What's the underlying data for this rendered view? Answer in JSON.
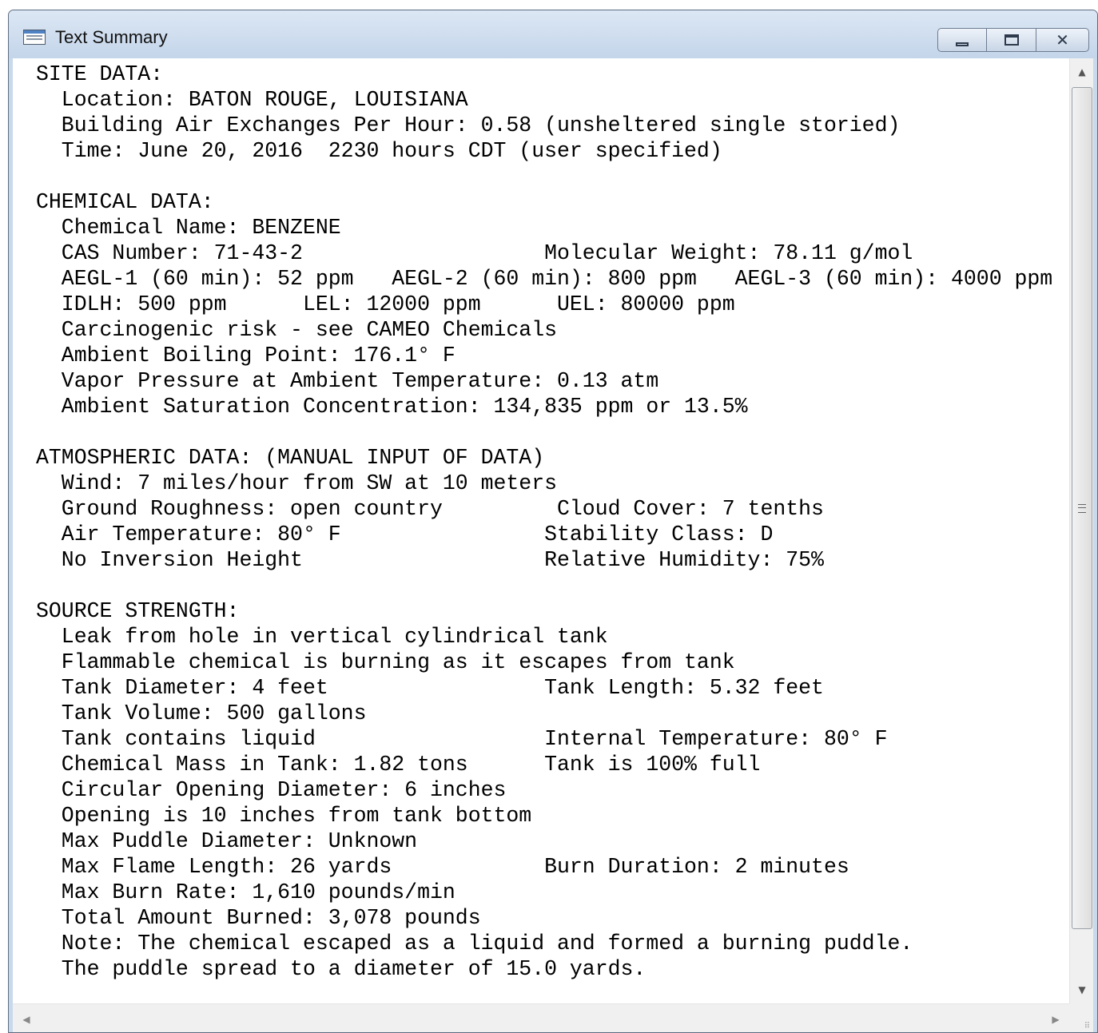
{
  "window": {
    "title": "Text Summary"
  },
  "controls": {
    "minimize": "–",
    "maximize": "□",
    "close": "✕"
  },
  "icons": {
    "title_icon": "text-document-icon",
    "up": "▲",
    "down": "▼",
    "left": "◀",
    "right": "▶",
    "grip": "⠿"
  },
  "content": {
    "lines": [
      "SITE DATA:",
      "  Location: BATON ROUGE, LOUISIANA",
      "  Building Air Exchanges Per Hour: 0.58 (unsheltered single storied)",
      "  Time: June 20, 2016  2230 hours CDT (user specified)",
      "",
      "CHEMICAL DATA:",
      "  Chemical Name: BENZENE",
      "  CAS Number: 71-43-2                   Molecular Weight: 78.11 g/mol",
      "  AEGL-1 (60 min): 52 ppm   AEGL-2 (60 min): 800 ppm   AEGL-3 (60 min): 4000 ppm",
      "  IDLH: 500 ppm      LEL: 12000 ppm      UEL: 80000 ppm",
      "  Carcinogenic risk - see CAMEO Chemicals",
      "  Ambient Boiling Point: 176.1° F",
      "  Vapor Pressure at Ambient Temperature: 0.13 atm",
      "  Ambient Saturation Concentration: 134,835 ppm or 13.5%",
      "",
      "ATMOSPHERIC DATA: (MANUAL INPUT OF DATA)",
      "  Wind: 7 miles/hour from SW at 10 meters",
      "  Ground Roughness: open country         Cloud Cover: 7 tenths",
      "  Air Temperature: 80° F                Stability Class: D",
      "  No Inversion Height                   Relative Humidity: 75%",
      "",
      "SOURCE STRENGTH:",
      "  Leak from hole in vertical cylindrical tank",
      "  Flammable chemical is burning as it escapes from tank",
      "  Tank Diameter: 4 feet                 Tank Length: 5.32 feet",
      "  Tank Volume: 500 gallons",
      "  Tank contains liquid                  Internal Temperature: 80° F",
      "  Chemical Mass in Tank: 1.82 tons      Tank is 100% full",
      "  Circular Opening Diameter: 6 inches",
      "  Opening is 10 inches from tank bottom",
      "  Max Puddle Diameter: Unknown",
      "  Max Flame Length: 26 yards            Burn Duration: 2 minutes",
      "  Max Burn Rate: 1,610 pounds/min",
      "  Total Amount Burned: 3,078 pounds",
      "  Note: The chemical escaped as a liquid and formed a burning puddle.",
      "  The puddle spread to a diameter of 15.0 yards."
    ]
  }
}
